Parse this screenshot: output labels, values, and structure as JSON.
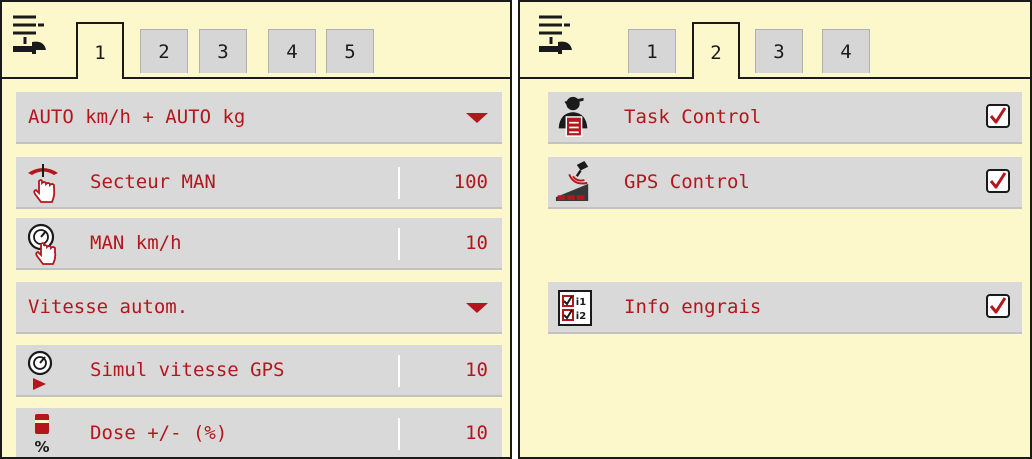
{
  "left_panel": {
    "tabs": [
      "1",
      "2",
      "3",
      "4",
      "5"
    ],
    "active_tab": "1",
    "rows": [
      {
        "type": "dropdown",
        "label": "AUTO km/h + AUTO kg"
      },
      {
        "type": "value",
        "icon": "boundary-sector-hand-icon",
        "label": "Secteur MAN",
        "value": "100"
      },
      {
        "type": "value",
        "icon": "speedometer-hand-icon",
        "label": "MAN km/h",
        "value": "10"
      },
      {
        "type": "dropdown",
        "label": "Vitesse autom."
      },
      {
        "type": "value",
        "icon": "speedometer-play-icon",
        "label": "Simul vitesse GPS",
        "value": "10"
      },
      {
        "type": "value",
        "icon": "fertilizer-percent-icon",
        "label": "Dose +/- (%)",
        "value": "10"
      }
    ]
  },
  "right_panel": {
    "tabs": [
      "1",
      "2",
      "3",
      "4"
    ],
    "active_tab": "2",
    "rows": [
      {
        "icon": "task-control-person-icon",
        "label": "Task Control",
        "checked": true
      },
      {
        "icon": "gps-satellite-icon",
        "label": "GPS Control",
        "checked": true
      },
      {
        "icon": "fertilizer-info-icon",
        "label": "Info engrais",
        "checked": true
      }
    ]
  },
  "colors": {
    "background": "#fcf8cc",
    "row": "#d9d9d9",
    "text": "#b3171b",
    "tab_inactive": "#d6d6d6"
  }
}
